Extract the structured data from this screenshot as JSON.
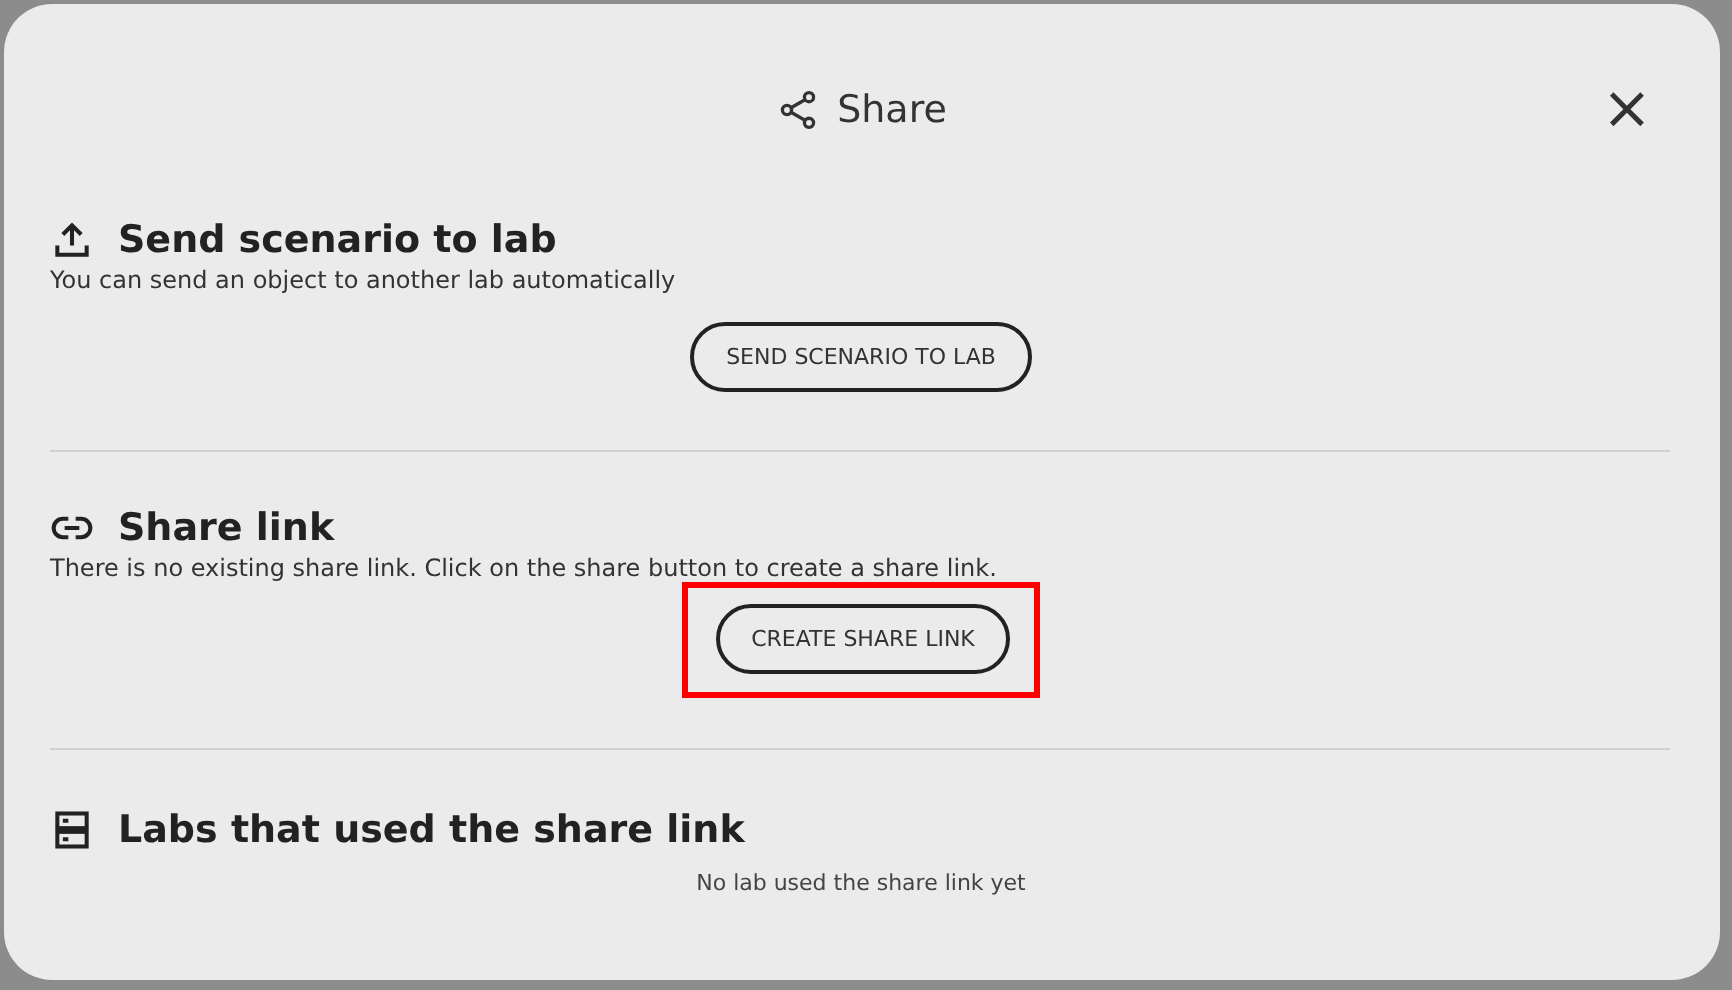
{
  "dialog": {
    "title": "Share",
    "close": "×"
  },
  "sections": [
    {
      "kind": "send",
      "title": "Send scenario to lab",
      "description": "You can send an object to another lab automatically",
      "button": {
        "label": "SEND SCENARIO TO LAB",
        "highlighted": false
      }
    },
    {
      "kind": "link",
      "title": "Share link",
      "description": "There is no existing share link. Click on the share button to create a share link.",
      "button": {
        "label": "CREATE SHARE LINK",
        "highlighted": true
      }
    },
    {
      "kind": "labs",
      "title": "Labs that used the share link",
      "empty_text": "No lab used the share link yet"
    }
  ]
}
